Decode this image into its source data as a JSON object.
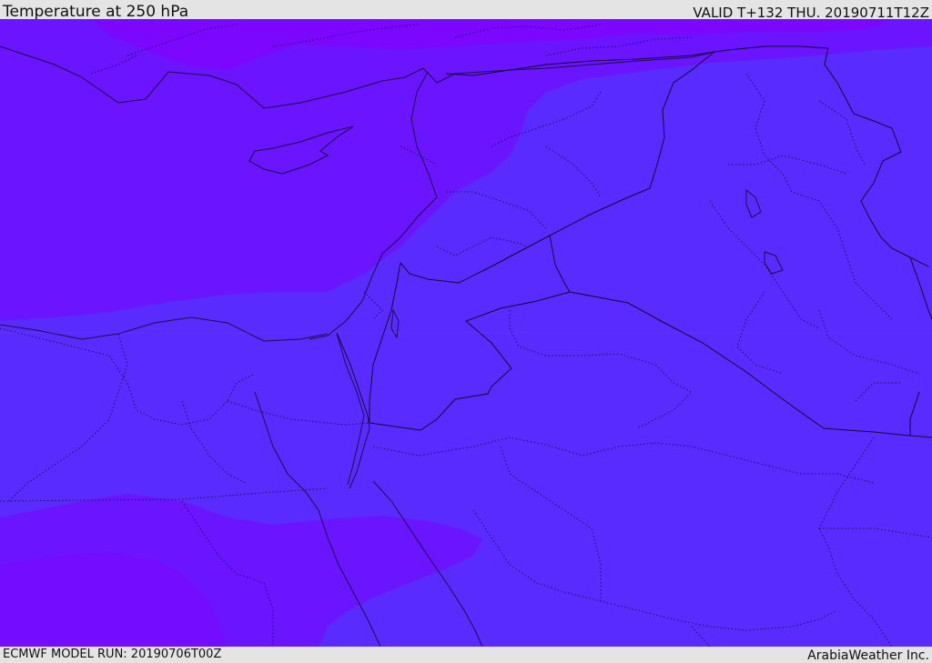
{
  "header": {
    "title": "Temperature at 250 hPa",
    "valid": "VALID T+132 THU. 20190711T12Z"
  },
  "footer": {
    "model_run": "ECMWF MODEL RUN: 20190706T00Z",
    "credit": "ArabiaWeather Inc."
  },
  "map": {
    "colors": {
      "warm_band": "#5a2bff",
      "cool_band": "#6a14ff",
      "cold_band": "#7b07ff",
      "coastline": "#1a1040",
      "border": "#120a30",
      "admin_border": "#1a1060"
    }
  }
}
